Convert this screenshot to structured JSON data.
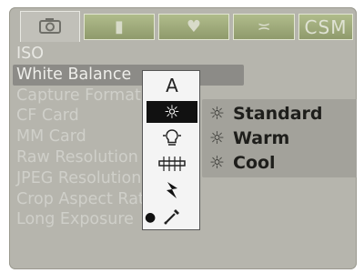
{
  "tabs": {
    "camera_icon": "camera-icon",
    "playback_icon": "playback-icon",
    "custom_icon": "custom-icon",
    "setup_icon": "setup-icon",
    "csm_label": "CSM"
  },
  "menu": {
    "items": [
      "ISO",
      "White Balance",
      "Capture Format",
      "CF Card",
      "MM Card",
      "Raw Resolution",
      "JPEG Resolution",
      "Crop Aspect Ratio",
      "Long Exposure"
    ],
    "selected_index": 1
  },
  "wb_popup": {
    "options": [
      {
        "name": "auto",
        "label": "A"
      },
      {
        "name": "daylight",
        "icon": "sun-icon",
        "selected": true
      },
      {
        "name": "tungsten",
        "icon": "bulb-icon"
      },
      {
        "name": "fluorescent",
        "icon": "fluorescent-icon"
      },
      {
        "name": "flash",
        "icon": "flash-icon"
      },
      {
        "name": "manual",
        "icon": "eyedropper-icon",
        "bullet": true
      }
    ]
  },
  "submenu": {
    "items": [
      {
        "icon": "sun-icon",
        "label": "Standard"
      },
      {
        "icon": "sun-icon",
        "label": "Warm"
      },
      {
        "icon": "sun-icon",
        "label": "Cool"
      }
    ]
  },
  "colors": {
    "screen_bg": "#b6b5ad",
    "tab_bg": "#9aa573",
    "selected_row": "#8c8b87",
    "popup_bg": "#f4f4f4",
    "submenu_bg": "#a3a29b"
  }
}
